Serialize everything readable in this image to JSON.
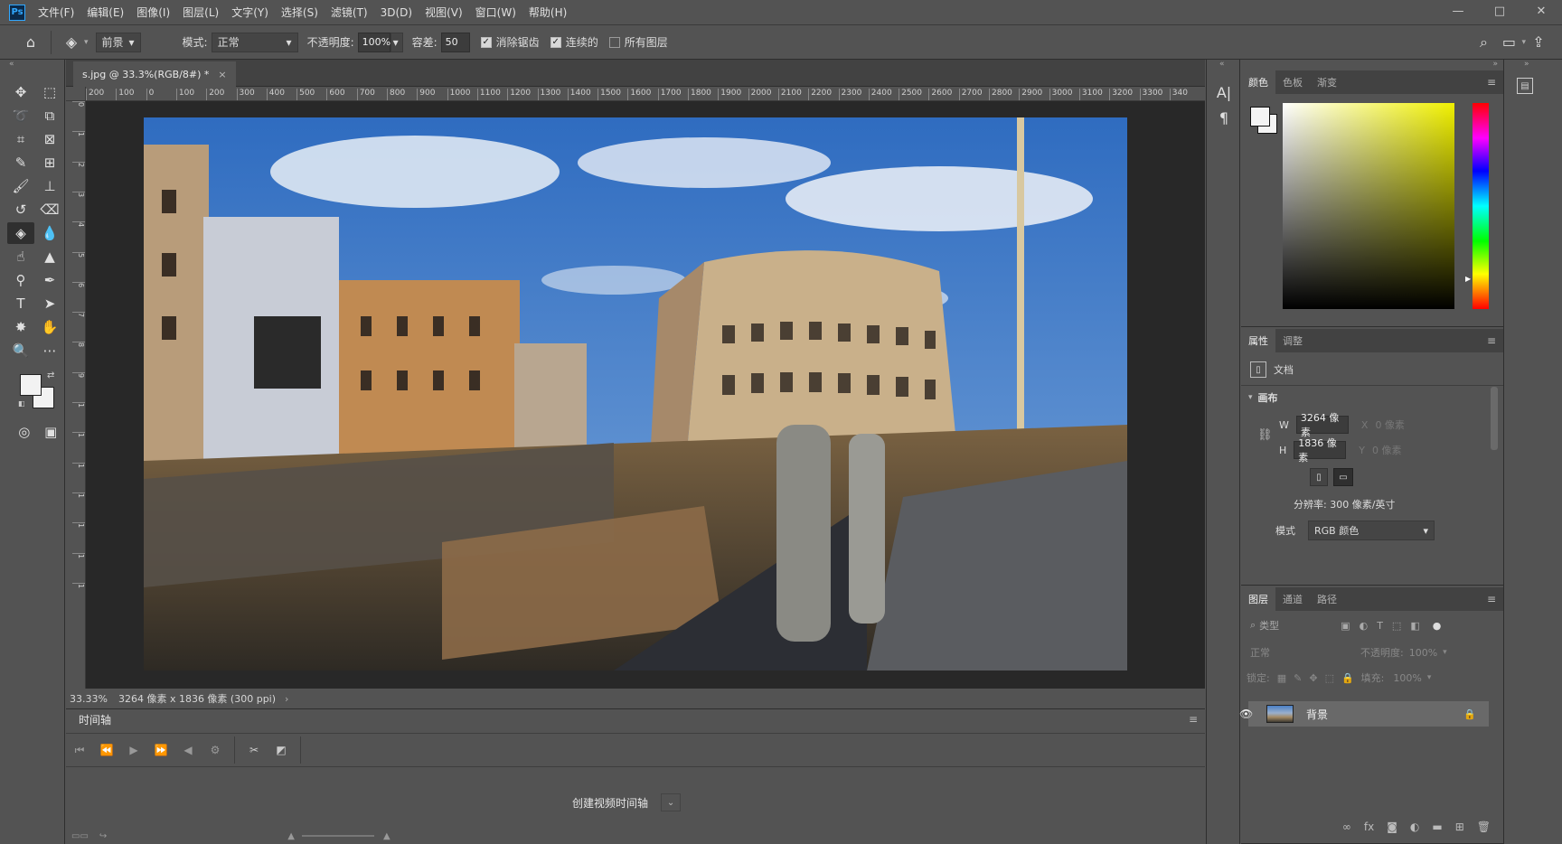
{
  "app": {
    "logo": "Ps",
    "menu": [
      "文件(F)",
      "编辑(E)",
      "图像(I)",
      "图层(L)",
      "文字(Y)",
      "选择(S)",
      "滤镜(T)",
      "3D(D)",
      "视图(V)",
      "窗口(W)",
      "帮助(H)"
    ],
    "window_controls": [
      "—",
      "□",
      "✕"
    ]
  },
  "options": {
    "fill_source": "前景",
    "mode_label": "模式:",
    "mode_value": "正常",
    "opacity_label": "不透明度:",
    "opacity_value": "100%",
    "tolerance_label": "容差:",
    "tolerance_value": "50",
    "antialias_label": "消除锯齿",
    "contiguous_label": "连续的",
    "all_layers_label": "所有图层"
  },
  "document": {
    "tab_title": "s.jpg @ 33.3%(RGB/8#) *",
    "zoom": "33.33%",
    "info": "3264 像素 x 1836 像素 (300 ppi)",
    "ruler_h": [
      "200",
      "100",
      "0",
      "100",
      "200",
      "300",
      "400",
      "500",
      "600",
      "700",
      "800",
      "900",
      "1000",
      "1100",
      "1200",
      "1300",
      "1400",
      "1500",
      "1600",
      "1700",
      "1800",
      "1900",
      "2000",
      "2100",
      "2200",
      "2300",
      "2400",
      "2500",
      "2600",
      "2700",
      "2800",
      "2900",
      "3000",
      "3100",
      "3200",
      "3300",
      "340"
    ],
    "ruler_v": [
      "0",
      "1",
      "2",
      "3",
      "4",
      "5",
      "6",
      "7",
      "8",
      "9",
      "1",
      "1",
      "1",
      "1",
      "1",
      "1",
      "1"
    ]
  },
  "timeline": {
    "title": "时间轴",
    "create_button": "创建视频时间轴"
  },
  "color_panel": {
    "tabs": [
      "颜色",
      "色板",
      "渐变"
    ]
  },
  "properties_panel": {
    "tabs": [
      "属性",
      "调整"
    ],
    "doc_label": "文档",
    "canvas_section": "画布",
    "w_label": "W",
    "w_value": "3264 像素",
    "x_label": "X",
    "x_value": "0 像素",
    "h_label": "H",
    "h_value": "1836 像素",
    "y_label": "Y",
    "y_value": "0 像素",
    "resolution": "分辨率: 300 像素/英寸",
    "mode_label": "模式",
    "mode_value": "RGB 颜色"
  },
  "layers_panel": {
    "tabs": [
      "图层",
      "通道",
      "路径"
    ],
    "filter_placeholder": "类型",
    "blend_mode": "正常",
    "opacity_label": "不透明度:",
    "opacity_value": "100%",
    "lock_label": "锁定:",
    "fill_label": "填充:",
    "fill_value": "100%",
    "layer_name": "背景"
  }
}
